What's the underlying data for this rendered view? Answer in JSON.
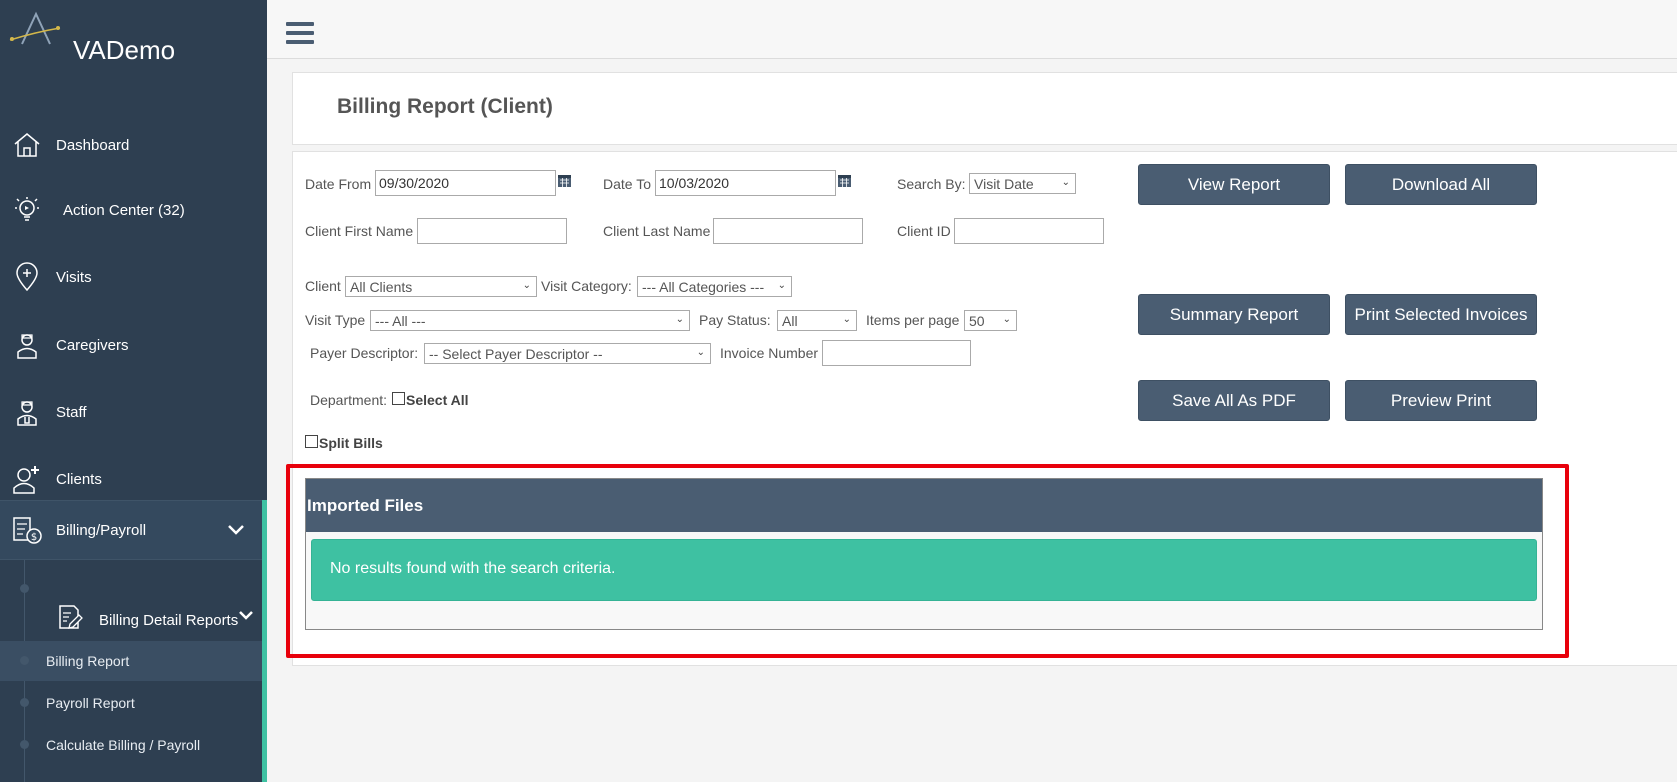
{
  "app": {
    "name": "VADemo"
  },
  "sidebar": {
    "items": [
      {
        "label": "Dashboard",
        "icon": "home-icon"
      },
      {
        "label": "Action Center (32)",
        "icon": "lightbulb-icon"
      },
      {
        "label": "Visits",
        "icon": "location-plus-icon"
      },
      {
        "label": "Caregivers",
        "icon": "caregiver-icon"
      },
      {
        "label": "Staff",
        "icon": "staff-icon"
      },
      {
        "label": "Clients",
        "icon": "client-icon"
      },
      {
        "label": "Billing/Payroll",
        "icon": "billing-icon"
      }
    ],
    "billing_detail_reports": {
      "label": "Billing Detail Reports",
      "icon": "report-edit-icon"
    },
    "sub_items": [
      {
        "label": "Billing Report",
        "active": true
      },
      {
        "label": "Payroll Report",
        "active": false
      },
      {
        "label": "Calculate Billing / Payroll",
        "active": false
      }
    ]
  },
  "page": {
    "title": "Billing Report (Client)"
  },
  "form": {
    "date_from_label": "Date From",
    "date_from_value": "09/30/2020",
    "date_to_label": "Date To",
    "date_to_value": "10/03/2020",
    "search_by_label": "Search By:",
    "search_by_value": "Visit Date",
    "client_first_name_label": "Client First Name",
    "client_first_name_value": "",
    "client_last_name_label": "Client Last Name",
    "client_last_name_value": "",
    "client_id_label": "Client ID",
    "client_id_value": "",
    "client_label": "Client",
    "client_value": "All Clients",
    "visit_category_label": "Visit Category:",
    "visit_category_value": "--- All Categories ---",
    "visit_type_label": "Visit Type",
    "visit_type_value": "--- All ---",
    "pay_status_label": "Pay Status:",
    "pay_status_value": "All",
    "items_per_page_label": "Items per page",
    "items_per_page_value": "50",
    "payer_descriptor_label": "Payer Descriptor:",
    "payer_descriptor_value": "-- Select Payer Descriptor --",
    "invoice_number_label": "Invoice Number",
    "invoice_number_value": "",
    "department_label": "Department:",
    "select_all_label": "Select All",
    "split_bills_label": "Split Bills"
  },
  "buttons": {
    "view_report": "View Report",
    "download_all": "Download All",
    "summary_report": "Summary Report",
    "print_selected_invoices": "Print Selected Invoices",
    "save_all_as_pdf": "Save All As PDF",
    "preview_print": "Preview Print"
  },
  "imported_files": {
    "title": "Imported Files",
    "message": "No results found with the search criteria."
  },
  "colors": {
    "sidebar_bg": "#2e3f51",
    "button_bg": "#4a5d72",
    "accent": "#3ec1a2",
    "highlight_box": "#e8000b"
  }
}
